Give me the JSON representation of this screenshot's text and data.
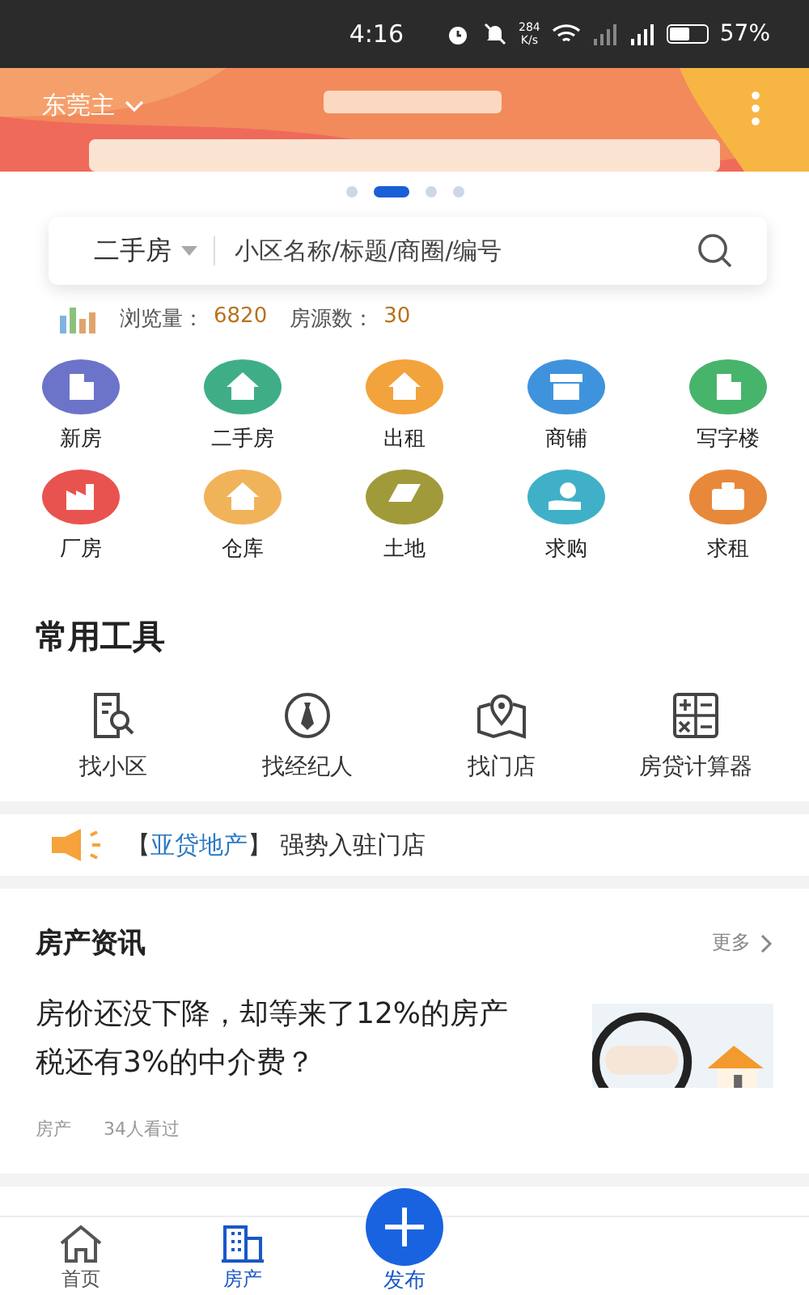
{
  "status_bar": {
    "time": "4:16",
    "speed_value": "284",
    "speed_unit": "K/s",
    "battery": "57%"
  },
  "banner": {
    "city": "东莞主",
    "kind": "picture"
  },
  "carousel": [
    {
      "selected": false
    },
    {
      "selected": true
    },
    {
      "selected": false
    },
    {
      "selected": false
    }
  ],
  "search": {
    "category": "二手房",
    "placeholder": "小区名称/标题/商圈/编号"
  },
  "stats": [
    {
      "label": "浏览量：",
      "value": "6820"
    },
    {
      "label": "房源数：",
      "value": "30"
    }
  ],
  "categories": [
    {
      "label": "新房",
      "color": "#6b74c9",
      "kind": "building"
    },
    {
      "label": "二手房",
      "color": "#3fae86",
      "kind": "house"
    },
    {
      "label": "出租",
      "color": "#f2a33c",
      "kind": "house"
    },
    {
      "label": "商铺",
      "color": "#3f93dd",
      "kind": "shop"
    },
    {
      "label": "写字楼",
      "color": "#47b46b",
      "kind": "building"
    },
    {
      "label": "厂房",
      "color": "#e9534f",
      "kind": "factory"
    },
    {
      "label": "仓库",
      "color": "#f0b35a",
      "kind": "house"
    },
    {
      "label": "土地",
      "color": "#a19a3a",
      "kind": "land"
    },
    {
      "label": "求购",
      "color": "#3fb0c8",
      "kind": "hand"
    },
    {
      "label": "求租",
      "color": "#e8883a",
      "kind": "case"
    }
  ],
  "tools": {
    "title": "常用工具",
    "items": [
      {
        "label": "找小区",
        "kind": "search"
      },
      {
        "label": "找经纪人",
        "kind": "agent"
      },
      {
        "label": "找门店",
        "kind": "map"
      },
      {
        "label": "房贷计算器",
        "kind": "calc"
      }
    ]
  },
  "notice": {
    "open": "【",
    "brand": "亚贷地产",
    "close": "】",
    "text": "强势入驻门店"
  },
  "news": {
    "title": "房产资讯",
    "more": "更多",
    "articles": [
      {
        "title": "房价还没下降，却等来了12%的房产税还有3%的中介费？",
        "tag": "房产",
        "views": "34人看过",
        "kind": "picture"
      }
    ]
  },
  "tabbar": [
    {
      "kind": "tab",
      "label": "首页",
      "selected": false
    },
    {
      "kind": "tab",
      "label": "房产",
      "selected": true
    },
    {
      "kind": "publish",
      "label": "发布",
      "selected": false
    }
  ]
}
